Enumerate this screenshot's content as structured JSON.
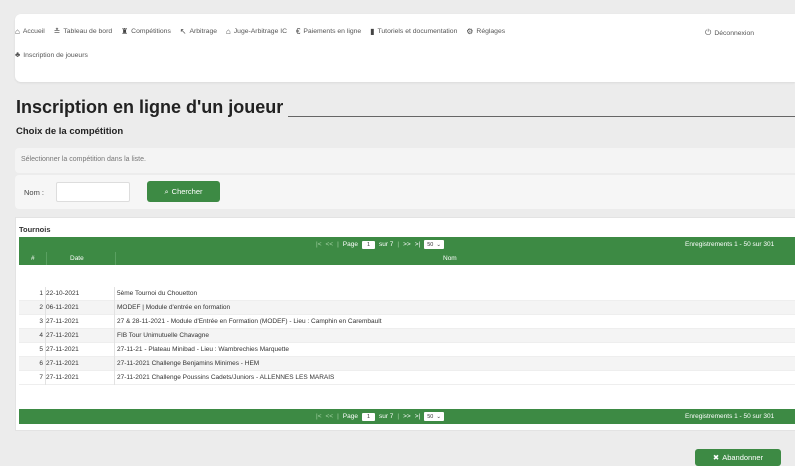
{
  "nav": {
    "items": [
      {
        "label": "Accueil",
        "icon": "home-icon",
        "glyph": "⌂"
      },
      {
        "label": "Tableau de bord",
        "icon": "dashboard-icon",
        "glyph": "≛"
      },
      {
        "label": "Compétitions",
        "icon": "trophy-icon",
        "glyph": "♜"
      },
      {
        "label": "Arbitrage",
        "icon": "whistle-icon",
        "glyph": "↖"
      },
      {
        "label": "Juge-Arbitrage IC",
        "icon": "building-icon",
        "glyph": "⌂"
      },
      {
        "label": "Paiements en ligne",
        "icon": "euro-icon",
        "glyph": "€"
      },
      {
        "label": "Tutoriels et documentation",
        "icon": "book-icon",
        "glyph": "▮"
      },
      {
        "label": "Réglages",
        "icon": "gear-icon",
        "glyph": "⚙"
      }
    ],
    "logout": {
      "label": "Déconnexion",
      "icon": "power-icon",
      "glyph": "⏻"
    },
    "second_row": {
      "label": "Inscription de joueurs",
      "icon": "users-icon",
      "glyph": "♣"
    }
  },
  "page": {
    "title": "Inscription en ligne d'un joueur",
    "subtitle": "Choix de la compétition",
    "hint": "Sélectionner la compétition dans la liste."
  },
  "search": {
    "label": "Nom :",
    "value": "",
    "placeholder": "",
    "button_label": "Chercher",
    "button_icon": "search-icon"
  },
  "table": {
    "title": "Tournois",
    "pager": {
      "page_label": "Page",
      "page_value": "1",
      "of_label": "sur 7",
      "page_size": "50",
      "records": "Enregistrements 1 - 50 sur 301"
    },
    "columns": [
      "#",
      "Date",
      "Nom"
    ],
    "rows": [
      {
        "num": "1",
        "date": "22-10-2021",
        "name": "5ème Tournoi du Chouetton"
      },
      {
        "num": "2",
        "date": "06-11-2021",
        "name": "MODEF | Module d'entrée en formation"
      },
      {
        "num": "3",
        "date": "27-11-2021",
        "name": "27 & 28-11-2021 - Module d'Entrée en Formation (MODEF) - Lieu : Camphin en Carembault"
      },
      {
        "num": "4",
        "date": "27-11-2021",
        "name": "FIB Tour Unimutuelle Chavagne"
      },
      {
        "num": "5",
        "date": "27-11-2021",
        "name": "27-11-21 - Plateau Minibad - Lieu : Wambrechies Marquette"
      },
      {
        "num": "6",
        "date": "27-11-2021",
        "name": "27-11-2021 Challenge Benjamins Minimes - HEM"
      },
      {
        "num": "7",
        "date": "27-11-2021",
        "name": "27-11-2021 Challenge Poussins Cadets/Juniors - ALLENNES LES MARAIS"
      }
    ]
  },
  "footer": {
    "abandon_label": "Abandonner",
    "abandon_icon": "close-icon"
  },
  "colors": {
    "accent": "#3d8a44",
    "background": "#ececec"
  }
}
